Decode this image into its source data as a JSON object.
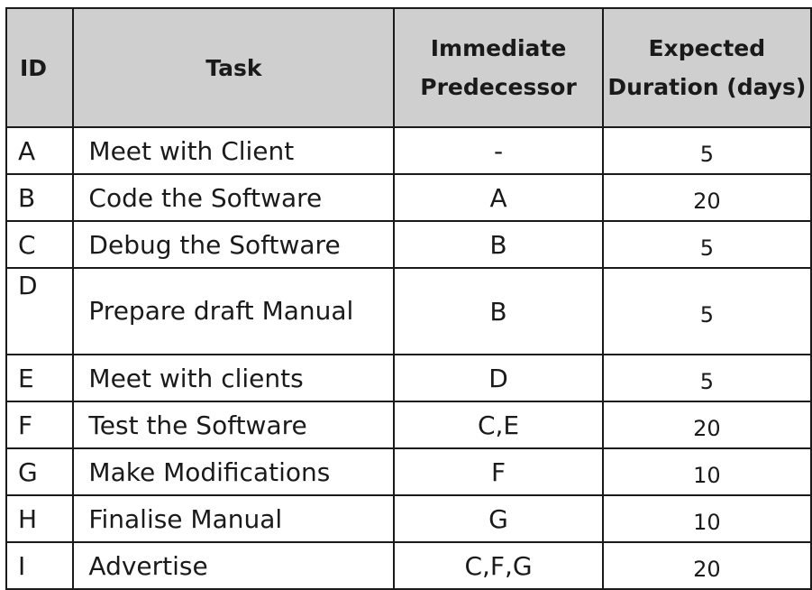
{
  "table": {
    "headers": {
      "id": "ID",
      "task": "Task",
      "predecessor": "Immediate Predecessor",
      "duration": "Expected Duration (days)"
    },
    "rows": [
      {
        "id": "A",
        "task": "Meet with Client",
        "predecessor": "-",
        "duration": "5"
      },
      {
        "id": "B",
        "task": "Code the Software",
        "predecessor": "A",
        "duration": "20"
      },
      {
        "id": "C",
        "task": "Debug the Software",
        "predecessor": "B",
        "duration": "5"
      },
      {
        "id": "D",
        "task": "Prepare draft Manual",
        "predecessor": "B",
        "duration": "5"
      },
      {
        "id": "E",
        "task": "Meet with clients",
        "predecessor": "D",
        "duration": "5"
      },
      {
        "id": "F",
        "task": "Test the Software",
        "predecessor": "C,E",
        "duration": "20"
      },
      {
        "id": "G",
        "task": "Make Modifications",
        "predecessor": "F",
        "duration": "10"
      },
      {
        "id": "H",
        "task": "Finalise Manual",
        "predecessor": "G",
        "duration": "10"
      },
      {
        "id": "I",
        "task": "Advertise",
        "predecessor": "C,F,G",
        "duration": "20"
      }
    ]
  }
}
